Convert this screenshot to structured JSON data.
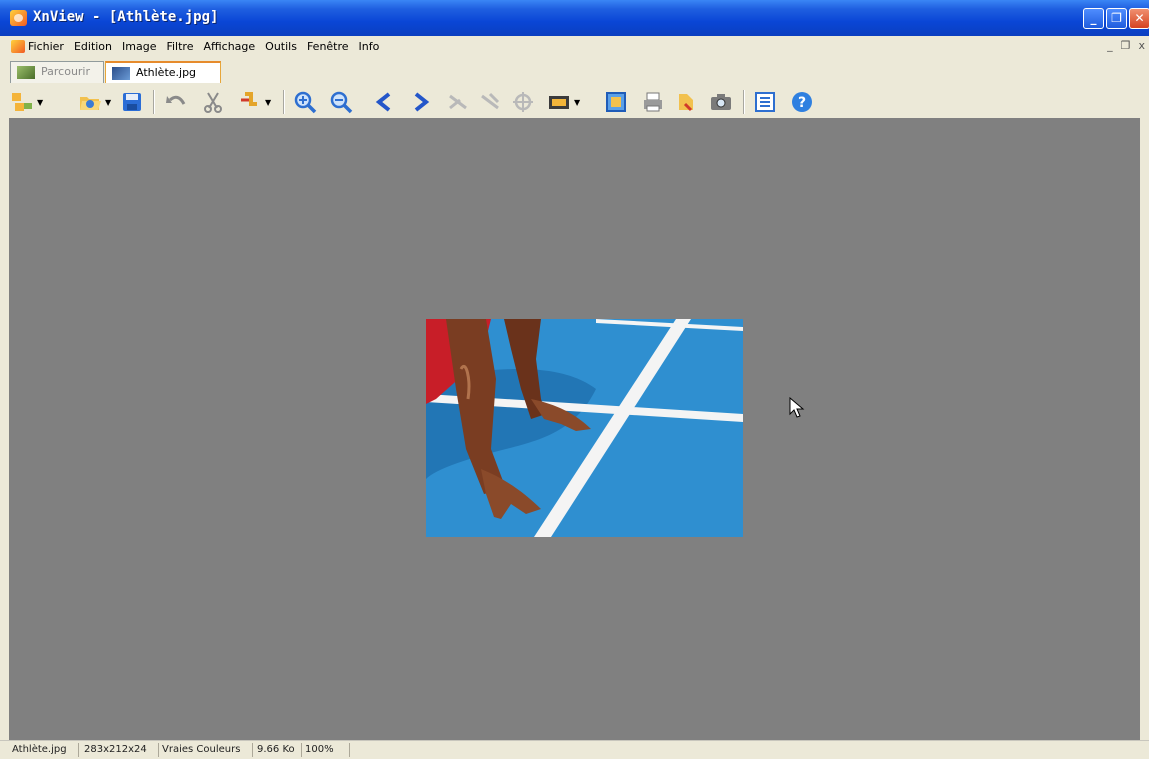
{
  "window": {
    "title": "XnView - [Athlète.jpg]",
    "buttons": {
      "minimize": "_",
      "restore": "❐",
      "close": "✕"
    }
  },
  "menu": {
    "items": [
      "Fichier",
      "Edition",
      "Image",
      "Filtre",
      "Affichage",
      "Outils",
      "Fenêtre",
      "Info"
    ],
    "mdi_controls": {
      "minimize": "_",
      "restore": "❐",
      "close": "x"
    }
  },
  "tabs": [
    {
      "label": "Parcourir",
      "active": false,
      "icon": "browser-icon"
    },
    {
      "label": "Athlète.jpg",
      "active": true,
      "icon": "image-icon"
    }
  ],
  "toolbar": {
    "buttons": [
      "browse-icon",
      "open-folder-icon",
      "save-icon",
      "undo-icon",
      "cut-icon",
      "rotate-icon",
      "zoom-in-icon",
      "zoom-out-icon",
      "previous-icon",
      "next-icon",
      "crop-icon",
      "resize-icon",
      "effects-icon",
      "slideshow-icon",
      "fullscreen-icon",
      "print-icon",
      "scan-icon",
      "capture-icon",
      "properties-icon",
      "help-icon"
    ]
  },
  "viewer": {
    "background": "#808080",
    "image_caption": ""
  },
  "status": {
    "filename": "Athlète.jpg",
    "dimensions": "283x212x24",
    "color_mode": "Vraies Couleurs",
    "file_size": "9.66 Ko",
    "zoom": "100%"
  }
}
